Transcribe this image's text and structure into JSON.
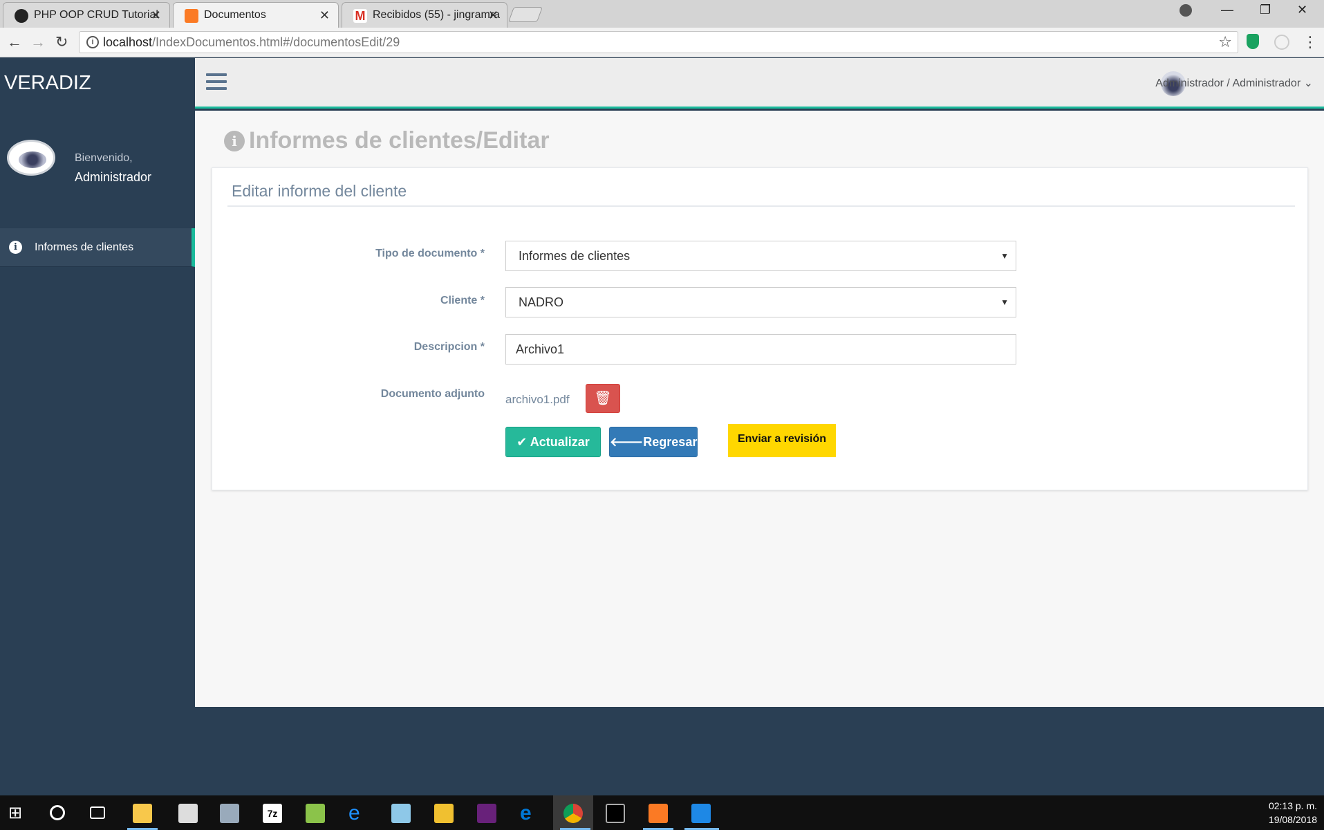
{
  "browser": {
    "tabs": [
      {
        "title": "PHP OOP CRUD Tutorial",
        "icon": "php-tutorial-favicon",
        "color": "#222222"
      },
      {
        "title": "Documentos",
        "icon": "xampp-favicon",
        "color": "#fb7a24"
      },
      {
        "title": "Recibidos (55) - jingramra",
        "icon": "gmail-favicon",
        "color": "#d93025"
      }
    ],
    "url_host": "localhost",
    "url_path": "/IndexDocumentos.html#/documentosEdit/29"
  },
  "sidebar": {
    "brand": "VERADIZ",
    "welcome": "Bienvenido,",
    "username": "Administrador",
    "menu": [
      {
        "label": "Informes de clientes",
        "icon": "info-circle-icon"
      }
    ]
  },
  "topnav": {
    "user": "Administrador / Administrador"
  },
  "page": {
    "title": "Informes de clientes/Editar",
    "panel_title": "Editar informe del cliente",
    "form": {
      "tipo_label": "Tipo de documento *",
      "tipo_value": "Informes de clientes",
      "cliente_label": "Cliente *",
      "cliente_value": "NADRO",
      "descripcion_label": "Descripcion *",
      "descripcion_value": "Archivo1",
      "adjunto_label": "Documento adjunto",
      "adjunto_file": "archivo1.pdf"
    },
    "buttons": {
      "update": "Actualizar",
      "back": "Regresar",
      "send": "Enviar a revisión"
    }
  },
  "taskbar": {
    "time": "02:13 p. m.",
    "date": "19/08/2018"
  },
  "colors": {
    "sidebar": "#2a3f54",
    "accent": "#1abb9c",
    "update_button": "#26b99a",
    "back_button": "#337ab7",
    "delete_button": "#d9534f",
    "send_button": "#ffd700"
  }
}
